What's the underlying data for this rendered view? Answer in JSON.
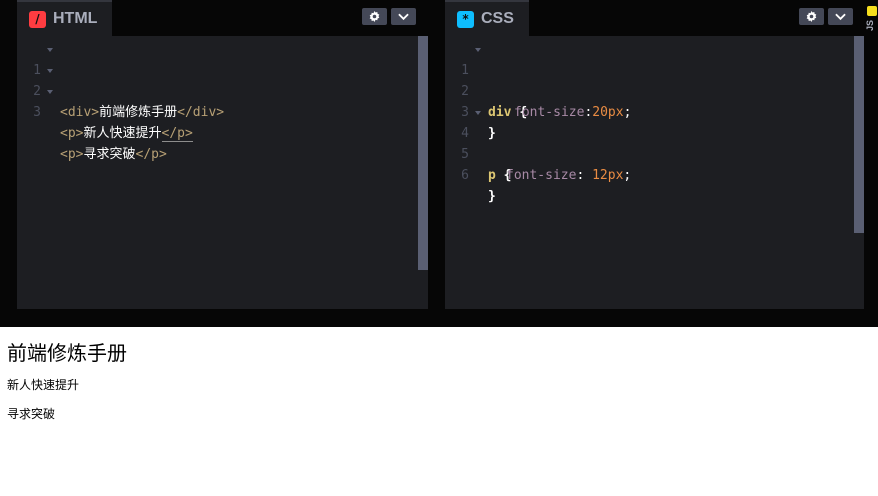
{
  "html_panel": {
    "title": "HTML",
    "icon": "html-icon",
    "icon_color": "#ff3c41",
    "lines": [
      {
        "num": "1",
        "open": "<div>",
        "text": "前端修炼手册",
        "close": "</div>"
      },
      {
        "num": "2",
        "open": "<p>",
        "text": "新人快速提升",
        "close": "</p>"
      },
      {
        "num": "3",
        "open": "<p>",
        "text": "寻求突破",
        "close": "</p>"
      }
    ]
  },
  "css_panel": {
    "title": "CSS",
    "icon": "css-icon",
    "icon_color": "#0ebeff",
    "lines": [
      {
        "num": "1",
        "selector": "div",
        "open": "{"
      },
      {
        "num": "2",
        "prop": "font-size",
        "colon": ":",
        "value": "20px",
        "semi": ";"
      },
      {
        "num": "3",
        "close": "}"
      },
      {
        "num": "4",
        "selector": "p",
        "open": "{"
      },
      {
        "num": "5",
        "prop": "font-size",
        "colon": ": ",
        "value": "12px",
        "semi": ";"
      },
      {
        "num": "6",
        "close": "}"
      }
    ]
  },
  "js_panel": {
    "title": "JS",
    "icon_color": "#f7df1e"
  },
  "preview": {
    "title": "前端修炼手册",
    "p1": "新人快速提升",
    "p2": "寻求突破"
  },
  "colors": {
    "editor_bg": "#1d1e22",
    "chrome_bg": "#060606",
    "tag": "#b7a075",
    "selector": "#dcc672",
    "property": "#a88aa6",
    "value": "#ea8c43"
  }
}
